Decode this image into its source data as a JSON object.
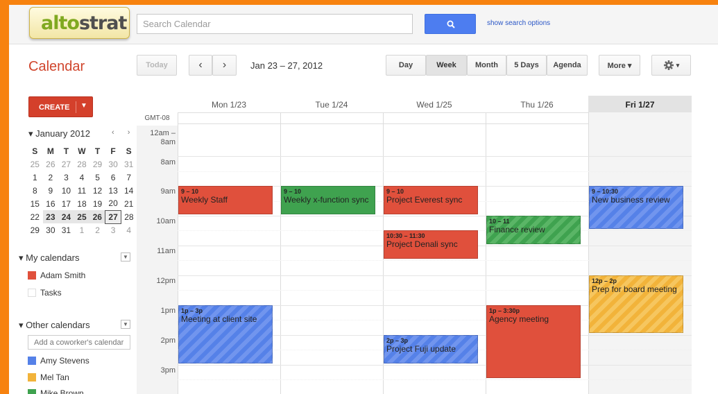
{
  "header": {
    "logo_text": "altostrat",
    "search_placeholder": "Search Calendar",
    "search_options": "show search options"
  },
  "toolbar": {
    "title": "Calendar",
    "today": "Today",
    "prev": "‹",
    "next": "›",
    "date_range": "Jan 23 – 27, 2012",
    "views": [
      "Day",
      "Week",
      "Month",
      "5 Days",
      "Agenda"
    ],
    "selected_view": "Week",
    "more": "More ▾",
    "settings_caret": "▾"
  },
  "sidebar": {
    "create": "CREATE",
    "create_arrow": "▼",
    "mini": {
      "month": "January 2012",
      "nav": "‹ ›",
      "weekdays": [
        "S",
        "M",
        "T",
        "W",
        "T",
        "F",
        "S"
      ],
      "weeks": [
        [
          "25",
          "26",
          "27",
          "28",
          "29",
          "30",
          "31"
        ],
        [
          "1",
          "2",
          "3",
          "4",
          "5",
          "6",
          "7"
        ],
        [
          "8",
          "9",
          "10",
          "11",
          "12",
          "13",
          "14"
        ],
        [
          "15",
          "16",
          "17",
          "18",
          "19",
          "20",
          "21"
        ],
        [
          "22",
          "23",
          "24",
          "25",
          "26",
          "27",
          "28"
        ],
        [
          "29",
          "30",
          "31",
          "1",
          "2",
          "3",
          "4"
        ]
      ]
    },
    "my_calendars": {
      "label": "My calendars",
      "items": [
        {
          "name": "Adam Smith",
          "color": "#e0503c"
        },
        {
          "name": "Tasks",
          "color": "#ffffff"
        }
      ]
    },
    "other_calendars": {
      "label": "Other calendars",
      "add_placeholder": "Add a coworker's calendar",
      "items": [
        {
          "name": "Amy Stevens",
          "color": "#5581e8"
        },
        {
          "name": "Mel Tan",
          "color": "#f2b33a"
        },
        {
          "name": "Mike Brown",
          "color": "#3fa24f"
        }
      ]
    }
  },
  "grid": {
    "timezone": "GMT-08",
    "days": [
      "Mon 1/23",
      "Tue 1/24",
      "Wed 1/25",
      "Thu 1/26",
      "Fri 1/27"
    ],
    "today_index": 4,
    "times": [
      "12am – 8am",
      "8am",
      "9am",
      "10am",
      "11am",
      "12pm",
      "1pm",
      "2pm",
      "3pm"
    ],
    "events": [
      {
        "time": "9 – 10",
        "title": "Weekly Staff",
        "color": "red"
      },
      {
        "time": "9 – 10",
        "title": "Weekly x-function sync",
        "color": "green"
      },
      {
        "time": "9 – 10",
        "title": "Project Everest sync",
        "color": "red"
      },
      {
        "time": "10:30 – 11:30",
        "title": "Project Denali sync",
        "color": "red"
      },
      {
        "time": "10 – 11",
        "title": "Finance review",
        "color": "greenst"
      },
      {
        "time": "9 – 10:30",
        "title": "New business review",
        "color": "blue"
      },
      {
        "time": "12p – 2p",
        "title": "Prep for board meeting",
        "color": "yellow"
      },
      {
        "time": "1p – 3p",
        "title": "Meeting at client site",
        "color": "blue"
      },
      {
        "time": "2p – 3p",
        "title": "Project Fuji update",
        "color": "blue"
      },
      {
        "time": "1p – 3:30p",
        "title": "Agency meeting",
        "color": "red"
      }
    ]
  }
}
